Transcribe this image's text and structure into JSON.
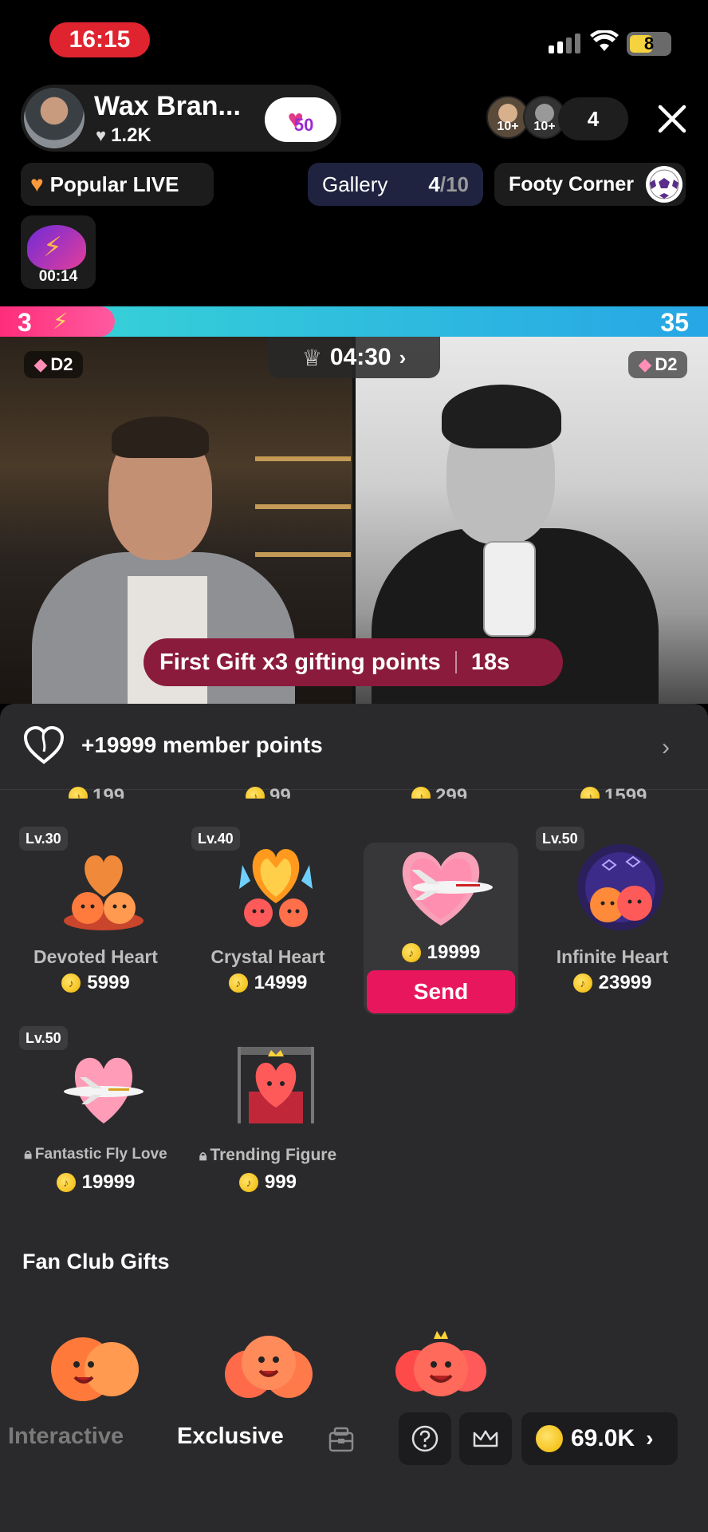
{
  "status_bar": {
    "time": "16:15",
    "battery": "8"
  },
  "host": {
    "name": "Wax Bran...",
    "likes": "1.2K",
    "level": "50"
  },
  "viewers": {
    "badge_a": "10+",
    "badge_b": "10+",
    "count": "4"
  },
  "chips": {
    "popular": "Popular LIVE",
    "gallery_label": "Gallery",
    "gallery_current": "4",
    "gallery_total": "/10",
    "footy": "Footy Corner"
  },
  "mini_gift": {
    "timer": "00:14"
  },
  "battle": {
    "left_score": "3",
    "right_score": "35",
    "timer": "04:30",
    "left_rank": "D2",
    "right_rank": "D2"
  },
  "banner": {
    "text": "First Gift x3 gifting points",
    "time": "18s"
  },
  "member": {
    "text": "+19999 member points"
  },
  "cut_prices": [
    "199",
    "99",
    "299",
    "1599"
  ],
  "gifts": [
    {
      "level": "Lv.30",
      "name": "Devoted Heart",
      "price": "5999"
    },
    {
      "level": "Lv.40",
      "name": "Crystal Heart",
      "price": "14999"
    },
    {
      "level": "",
      "name": "",
      "price": "19999",
      "selected": true,
      "send_label": "Send"
    },
    {
      "level": "Lv.50",
      "name": "Infinite Heart",
      "price": "23999"
    },
    {
      "level": "Lv.50",
      "name": "Fantastic Fly Love",
      "price": "19999",
      "locked": true
    },
    {
      "level": "",
      "name": "Trending Figure",
      "price": "999",
      "locked": true
    }
  ],
  "section": {
    "fan_club": "Fan Club Gifts"
  },
  "bottom": {
    "tab_interactive": "Interactive",
    "tab_exclusive": "Exclusive",
    "coins": "69.0K"
  },
  "colors": {
    "accent": "#e8175d",
    "banner": "#8a1b3c",
    "bar_left": "#ff2d7a",
    "bar_right": "#27a6e5"
  }
}
